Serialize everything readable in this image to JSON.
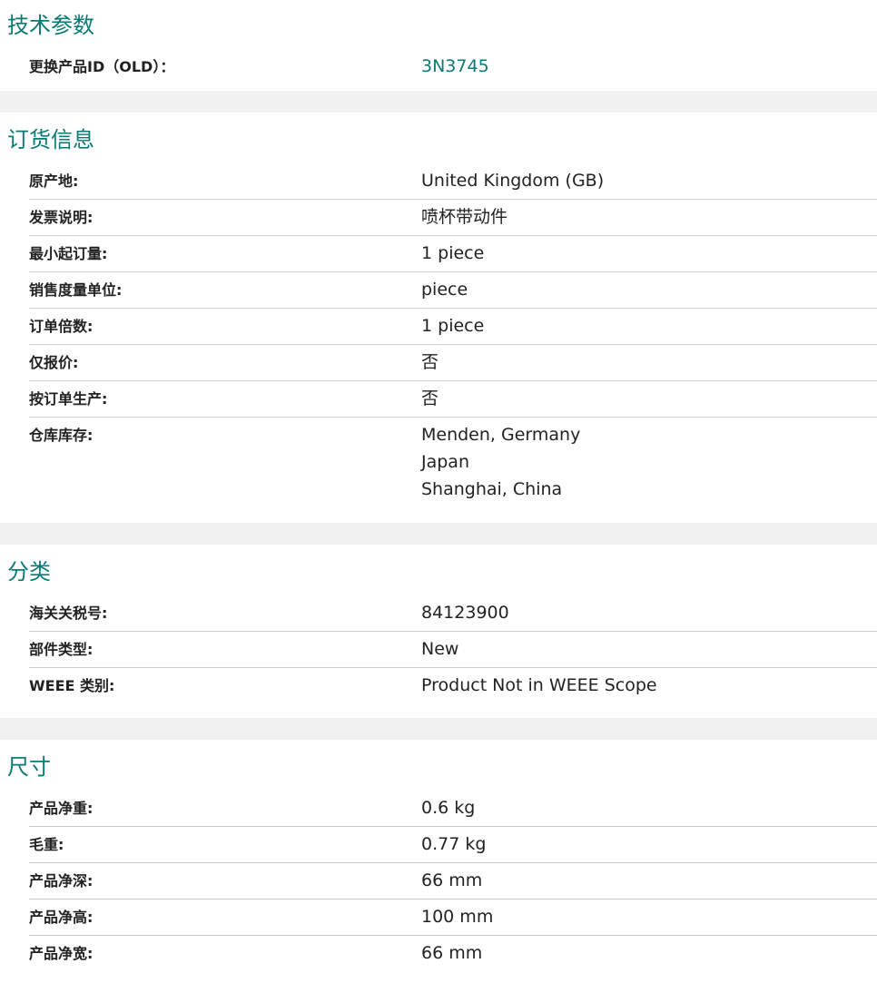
{
  "sections": {
    "tech": {
      "title": "技术参数",
      "rows": [
        {
          "label": "更换产品ID（OLD）：",
          "value": "3N3745"
        }
      ]
    },
    "order": {
      "title": "订货信息",
      "rows": [
        {
          "label": "原产地:",
          "value": "United Kingdom (GB)"
        },
        {
          "label": "发票说明:",
          "value": "喷杯带动件"
        },
        {
          "label": "最小起订量:",
          "value": "1 piece"
        },
        {
          "label": "销售度量单位:",
          "value": "piece"
        },
        {
          "label": "订单倍数:",
          "value": "1 piece"
        },
        {
          "label": "仅报价:",
          "value": "否"
        },
        {
          "label": "按订单生产:",
          "value": "否"
        },
        {
          "label": "仓库库存:",
          "values": [
            "Menden, Germany",
            "Japan",
            "Shanghai, China"
          ]
        }
      ]
    },
    "classification": {
      "title": "分类",
      "rows": [
        {
          "label": "海关关税号:",
          "value": "84123900"
        },
        {
          "label": "部件类型:",
          "value": "New"
        },
        {
          "label": "WEEE 类别:",
          "value": "Product Not in WEEE Scope"
        }
      ]
    },
    "dimensions": {
      "title": "尺寸",
      "rows": [
        {
          "label": "产品净重:",
          "value": "0.6 kg"
        },
        {
          "label": "毛重:",
          "value": "0.77 kg"
        },
        {
          "label": "产品净深:",
          "value": "66 mm"
        },
        {
          "label": "产品净高:",
          "value": "100 mm"
        },
        {
          "label": "产品净宽:",
          "value": "66 mm"
        }
      ]
    }
  },
  "colors": {
    "accent": "#0b7a75",
    "separator": "#f1f1f1",
    "row_border": "#d0d0d0"
  }
}
